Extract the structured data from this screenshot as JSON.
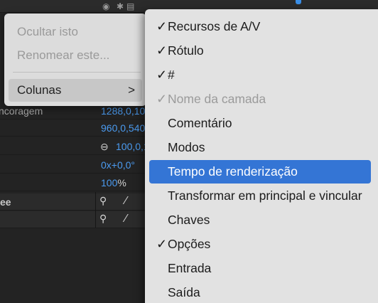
{
  "background_panel": {
    "rows": [
      {
        "label": "ncoragem",
        "value": "1288,0,10"
      },
      {
        "label": "",
        "value": "960,0,540,"
      },
      {
        "label": "",
        "link": true,
        "value": "100,0,1"
      },
      {
        "label": "",
        "value": "0x+0,0°"
      },
      {
        "label": "",
        "value": "100",
        "suffix": "%"
      }
    ],
    "layer_rows": [
      {
        "name": "ee"
      },
      {
        "name": ""
      }
    ],
    "colors": {
      "value_blue": "#4b9bf0",
      "progress_green": "#3f8f1f"
    }
  },
  "context_menu": {
    "items": [
      {
        "label": "Ocultar isto",
        "enabled": false
      },
      {
        "label": "Renomear este...",
        "enabled": false
      }
    ],
    "submenu_item": {
      "label": "Colunas",
      "chevron": ">"
    }
  },
  "columns_menu": {
    "items": [
      {
        "label": "Recursos de A/V",
        "checked": true,
        "enabled": true,
        "highlighted": false
      },
      {
        "label": "Rótulo",
        "checked": true,
        "enabled": true,
        "highlighted": false
      },
      {
        "label": "#",
        "checked": true,
        "enabled": true,
        "highlighted": false
      },
      {
        "label": "Nome da camada",
        "checked": true,
        "enabled": false,
        "highlighted": false
      },
      {
        "label": "Comentário",
        "checked": false,
        "enabled": true,
        "highlighted": false
      },
      {
        "label": "Modos",
        "checked": false,
        "enabled": true,
        "highlighted": false
      },
      {
        "label": "Tempo de renderização",
        "checked": false,
        "enabled": true,
        "highlighted": true
      },
      {
        "label": "Transformar em principal e vincular",
        "checked": false,
        "enabled": true,
        "highlighted": false
      },
      {
        "label": "Chaves",
        "checked": false,
        "enabled": true,
        "highlighted": false
      },
      {
        "label": "Opções",
        "checked": true,
        "enabled": true,
        "highlighted": false
      },
      {
        "label": "Entrada",
        "checked": false,
        "enabled": true,
        "highlighted": false
      },
      {
        "label": "Saída",
        "checked": false,
        "enabled": true,
        "highlighted": false
      }
    ],
    "check_glyph": "✓",
    "highlight_color": "#3475d5"
  }
}
